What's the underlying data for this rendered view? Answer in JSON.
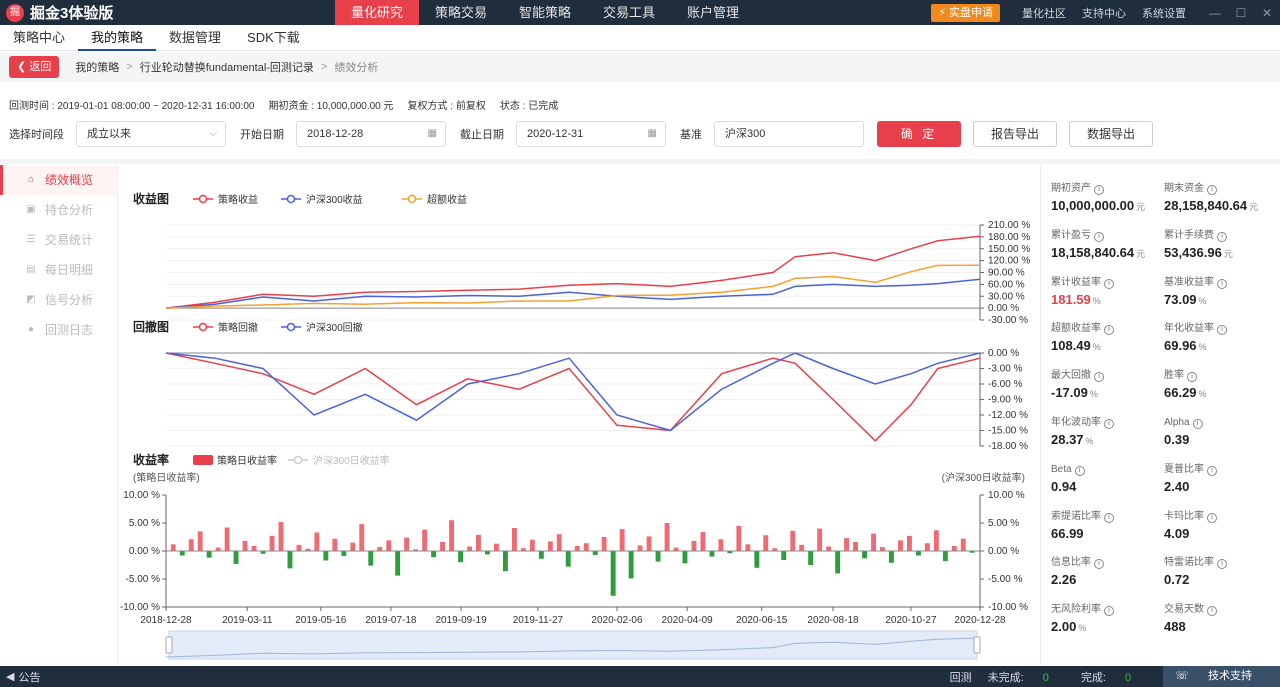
{
  "app": {
    "logo_glyph": "掘",
    "title": "掘金3体验版",
    "main_nav": [
      "量化研究",
      "策略交易",
      "智能策略",
      "交易工具",
      "账户管理"
    ],
    "active_nav": 0,
    "live_button": "实盘申请",
    "top_links": [
      "量化社区",
      "支持中心",
      "系统设置"
    ],
    "window_controls": [
      "—",
      "☐",
      "✕"
    ]
  },
  "subnav": {
    "items": [
      "策略中心",
      "我的策略",
      "数据管理",
      "SDK下载"
    ],
    "active": 1
  },
  "breadcrumb": {
    "back_label": "返回",
    "items": [
      "我的策略",
      "行业轮动替换fundamental-回测记录",
      "绩效分析"
    ],
    "separator": ">"
  },
  "info": {
    "time_range": "回测时间 : 2019-01-01 08:00:00 ~ 2020-12-31 16:00:00",
    "initial_capital": "期初资金 : 10,000,000.00 元",
    "adjust": "复权方式 : 前复权",
    "status": "状态 : 已完成"
  },
  "filters": {
    "period_label": "选择时间段",
    "period_value": "成立以来",
    "start_label": "开始日期",
    "start_value": "2018-12-28",
    "end_label": "截止日期",
    "end_value": "2020-12-31",
    "benchmark_label": "基准",
    "benchmark_value": "沪深300",
    "confirm_label": "确 定",
    "report_export": "报告导出",
    "data_export": "数据导出"
  },
  "sidebar": {
    "items": [
      "绩效概览",
      "持仓分析",
      "交易统计",
      "每日明细",
      "信号分析",
      "回测日志"
    ],
    "active": 0
  },
  "colors": {
    "strategy": "#e8404a",
    "benchmark": "#4a63d8",
    "excess": "#f5a030",
    "positive_bar": "#ef6b74",
    "negative_bar": "#2e9e3c",
    "accent": "#e8404a",
    "titlebar": "#1f2d3d"
  },
  "chart_data": [
    {
      "type": "line",
      "title": "收益图",
      "series": [
        {
          "name": "策略收益",
          "x": [
            "2018-12-28",
            "2019-02-10",
            "2019-03-25",
            "2019-05-10",
            "2019-06-25",
            "2019-08-10",
            "2019-09-25",
            "2019-11-10",
            "2019-12-25",
            "2020-02-06",
            "2020-03-25",
            "2020-05-10",
            "2020-06-25",
            "2020-07-15",
            "2020-08-18",
            "2020-09-25",
            "2020-10-27",
            "2020-11-20",
            "2020-12-28"
          ],
          "values": [
            0,
            15,
            35,
            30,
            40,
            42,
            45,
            48,
            58,
            62,
            55,
            70,
            90,
            130,
            140,
            120,
            150,
            170,
            181.59
          ]
        },
        {
          "name": "沪深300收益",
          "x": [
            "2018-12-28",
            "2019-02-10",
            "2019-03-25",
            "2019-05-10",
            "2019-06-25",
            "2019-08-10",
            "2019-09-25",
            "2019-11-10",
            "2019-12-25",
            "2020-02-06",
            "2020-03-25",
            "2020-05-10",
            "2020-06-25",
            "2020-07-15",
            "2020-08-18",
            "2020-09-25",
            "2020-10-27",
            "2020-11-20",
            "2020-12-28"
          ],
          "values": [
            0,
            10,
            28,
            18,
            30,
            28,
            32,
            30,
            40,
            30,
            22,
            30,
            35,
            55,
            60,
            55,
            58,
            62,
            73.09
          ]
        },
        {
          "name": "超额收益",
          "x": [
            "2018-12-28",
            "2019-02-10",
            "2019-03-25",
            "2019-05-10",
            "2019-06-25",
            "2019-08-10",
            "2019-09-25",
            "2019-11-10",
            "2019-12-25",
            "2020-02-06",
            "2020-03-25",
            "2020-05-10",
            "2020-06-25",
            "2020-07-15",
            "2020-08-18",
            "2020-09-25",
            "2020-10-27",
            "2020-11-20",
            "2020-12-28"
          ],
          "values": [
            0,
            5,
            8,
            12,
            10,
            14,
            13,
            18,
            18,
            32,
            33,
            40,
            55,
            75,
            80,
            65,
            92,
            108,
            108.49
          ]
        }
      ],
      "yticks": [
        "210.00 %",
        "180.00 %",
        "150.00 %",
        "120.00 %",
        "90.00 %",
        "60.00 %",
        "30.00 %",
        "0.00 %",
        "-30.00 %"
      ],
      "ylim": [
        -30,
        210
      ]
    },
    {
      "type": "line",
      "title": "回撤图",
      "series": [
        {
          "name": "策略回撤",
          "x": [
            "2018-12-28",
            "2019-02-10",
            "2019-03-25",
            "2019-05-10",
            "2019-06-25",
            "2019-08-10",
            "2019-09-25",
            "2019-11-10",
            "2019-12-25",
            "2020-02-06",
            "2020-03-25",
            "2020-05-10",
            "2020-06-25",
            "2020-07-15",
            "2020-08-18",
            "2020-09-25",
            "2020-10-27",
            "2020-11-20",
            "2020-12-28"
          ],
          "values": [
            0,
            -2,
            -4,
            -8,
            -3,
            -10,
            -5,
            -7,
            -3,
            -14,
            -15,
            -4,
            -1,
            -2,
            -9,
            -17,
            -10,
            -3,
            -1
          ]
        },
        {
          "name": "沪深300回撤",
          "x": [
            "2018-12-28",
            "2019-02-10",
            "2019-03-25",
            "2019-05-10",
            "2019-06-25",
            "2019-08-10",
            "2019-09-25",
            "2019-11-10",
            "2019-12-25",
            "2020-02-06",
            "2020-03-25",
            "2020-05-10",
            "2020-06-25",
            "2020-07-15",
            "2020-08-18",
            "2020-09-25",
            "2020-10-27",
            "2020-11-20",
            "2020-12-28"
          ],
          "values": [
            0,
            -1,
            -3,
            -12,
            -8,
            -13,
            -6,
            -4,
            -1,
            -12,
            -15,
            -7,
            -2,
            0,
            -3,
            -6,
            -4,
            -2,
            0
          ]
        }
      ],
      "yticks": [
        "0.00 %",
        "-3.00 %",
        "-6.00 %",
        "-9.00 %",
        "-12.00 %",
        "-15.00 %",
        "-18.00 %"
      ],
      "ylim": [
        -18,
        0
      ]
    },
    {
      "type": "bar",
      "title": "收益率",
      "series": [
        {
          "name": "策略日收益率"
        },
        {
          "name": "沪深300日收益率"
        }
      ],
      "left_axis_label": "(策略日收益率)",
      "right_axis_label": "(沪深300日收益率)",
      "yticks": [
        "10.00 %",
        "5.00 %",
        "0.00 %",
        "-5.00 %",
        "-10.00 %"
      ],
      "ylim": [
        -10,
        10
      ],
      "xticks": [
        "2018-12-28",
        "2019-03-11",
        "2019-05-16",
        "2019-07-18",
        "2019-09-19",
        "2019-11-27",
        "2020-02-06",
        "2020-04-09",
        "2020-06-15",
        "2020-08-18",
        "2020-10-27",
        "2020-12-28"
      ],
      "daily_returns": [
        1.2,
        -0.8,
        2.1,
        3.5,
        -1.2,
        0.6,
        4.2,
        -2.3,
        1.8,
        0.9,
        -0.5,
        2.7,
        5.2,
        -3.1,
        1.1,
        0.4,
        3.3,
        -1.7,
        2.2,
        -0.9,
        1.5,
        4.8,
        -2.6,
        0.7,
        1.9,
        -4.4,
        2.4,
        0.3,
        3.8,
        -1.1,
        1.6,
        5.5,
        -2.0,
        0.8,
        2.9,
        -0.6,
        1.3,
        -3.6,
        4.1,
        0.5,
        2.0,
        -1.4,
        1.7,
        3.0,
        -2.8,
        0.9,
        1.4,
        -0.7,
        2.5,
        -8.0,
        3.9,
        -4.9,
        1.0,
        2.6,
        -1.9,
        5.0,
        0.6,
        -2.2,
        1.8,
        3.4,
        -1.0,
        2.1,
        -0.4,
        4.5,
        1.2,
        -3.0,
        2.8,
        0.5,
        -1.6,
        3.6,
        1.1,
        -2.5,
        4.0,
        0.8,
        -4.0,
        2.3,
        1.6,
        -1.3,
        3.1,
        0.7,
        -2.1,
        1.9,
        2.7,
        -0.8,
        1.4,
        3.7,
        -1.8,
        0.9,
        2.2,
        -0.3
      ]
    }
  ],
  "metrics": [
    {
      "label": "期初资产",
      "value": "10,000,000.00",
      "unit": "元"
    },
    {
      "label": "期末资金",
      "value": "28,158,840.64",
      "unit": "元"
    },
    {
      "label": "累计盈亏",
      "value": "18,158,840.64",
      "unit": "元"
    },
    {
      "label": "累计手续费",
      "value": "53,436.96",
      "unit": "元"
    },
    {
      "label": "累计收益率",
      "value": "181.59",
      "unit": "%",
      "highlight": true
    },
    {
      "label": "基准收益率",
      "value": "73.09",
      "unit": "%"
    },
    {
      "label": "超额收益率",
      "value": "108.49",
      "unit": "%"
    },
    {
      "label": "年化收益率",
      "value": "69.96",
      "unit": "%"
    },
    {
      "label": "最大回撤",
      "value": "-17.09",
      "unit": "%"
    },
    {
      "label": "胜率",
      "value": "66.29",
      "unit": "%"
    },
    {
      "label": "年化波动率",
      "value": "28.37",
      "unit": "%"
    },
    {
      "label": "Alpha",
      "value": "0.39",
      "unit": ""
    },
    {
      "label": "Beta",
      "value": "0.94",
      "unit": ""
    },
    {
      "label": "夏普比率",
      "value": "2.40",
      "unit": ""
    },
    {
      "label": "索提诺比率",
      "value": "66.99",
      "unit": ""
    },
    {
      "label": "卡玛比率",
      "value": "4.09",
      "unit": ""
    },
    {
      "label": "信息比率",
      "value": "2.26",
      "unit": ""
    },
    {
      "label": "特雷诺比率",
      "value": "0.72",
      "unit": ""
    },
    {
      "label": "无风险利率",
      "value": "2.00",
      "unit": "%"
    },
    {
      "label": "交易天数",
      "value": "488",
      "unit": ""
    }
  ],
  "statusbar": {
    "notice": "公告",
    "backtest": "回测",
    "unfinished_label": "未完成:",
    "unfinished_count": "0",
    "finished_label": "完成:",
    "finished_count": "0",
    "support": "技术支持"
  }
}
